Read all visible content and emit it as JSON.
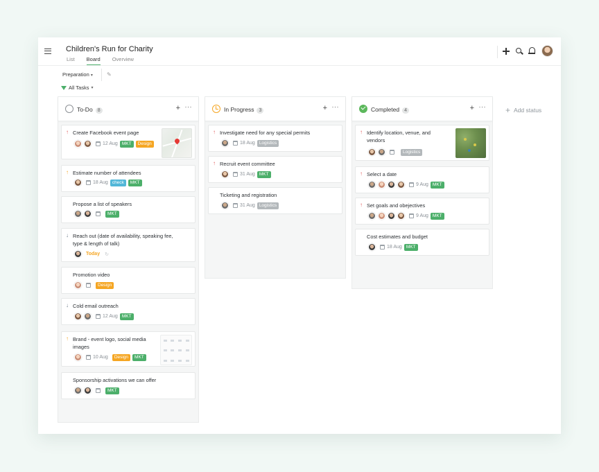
{
  "header": {
    "project_title": "Children's Run for Charity",
    "tabs": [
      {
        "label": "List"
      },
      {
        "label": "Board"
      },
      {
        "label": "Overview"
      }
    ],
    "active_tab": "Board",
    "icons": [
      "plus-icon",
      "search-icon",
      "bell-icon",
      "user-avatar"
    ]
  },
  "toolbar": {
    "section_label": "Preparation",
    "filter_label": "All Tasks"
  },
  "colors": {
    "accent_green": "#4caf6a",
    "design_orange": "#f5a623",
    "check_blue": "#52b7d8",
    "logistics_gray": "#b3b8bb",
    "priority_high": "#e05a5a"
  },
  "columns": [
    {
      "title": "To-Do",
      "count": "8",
      "cards": [
        {
          "title": "Create Facebook event page",
          "date": "12 Aug",
          "tags": [
            "MKT",
            "Design"
          ]
        },
        {
          "title": "Estimate number of attendees",
          "date": "18 Aug",
          "tags": [
            "check",
            "MKT"
          ]
        },
        {
          "title": "Propose a list of speakers",
          "date": "",
          "tags": [
            "MKT"
          ]
        },
        {
          "title_line1": "Reach out (date of availability, speaking fee,",
          "title_line2": "type & length of talk)",
          "date": "Today",
          "tags": []
        },
        {
          "title": "Promotion video",
          "date": "",
          "tags": [
            "Design"
          ]
        },
        {
          "title": "Cold email outreach",
          "date": "12 Aug",
          "tags": [
            "MKT"
          ]
        },
        {
          "title_line1": "Brand - event logo, social media",
          "title_line2": "images",
          "date": "10 Aug",
          "tags": [
            "Design",
            "MKT"
          ]
        },
        {
          "title": "Sponsorship activations we can offer",
          "date": "",
          "tags": [
            "MKT"
          ]
        }
      ]
    },
    {
      "title": "In Progress",
      "count": "3",
      "cards": [
        {
          "title": "Investigate need for any special permits",
          "date": "18 Aug",
          "tags": [
            "Logistics"
          ]
        },
        {
          "title": "Recruit event committee",
          "date": "31 Aug",
          "tags": [
            "MKT"
          ]
        },
        {
          "title": "Ticketing and registration",
          "date": "31 Aug",
          "tags": [
            "Logistics"
          ]
        }
      ]
    },
    {
      "title": "Completed",
      "count": "4",
      "cards": [
        {
          "title_line1": "Identify location, venue, and",
          "title_line2": "vendors",
          "date": "",
          "tags": [
            "Logistics"
          ]
        },
        {
          "title": "Select a date",
          "date": "9 Aug",
          "tags": [
            "MKT"
          ]
        },
        {
          "title": "Set goals and obejectives",
          "date": "9 Aug",
          "tags": [
            "MKT"
          ]
        },
        {
          "title": "Cost estimates and budget",
          "date": "18 Aug",
          "tags": [
            "MKT"
          ]
        }
      ]
    }
  ],
  "add_status_label": "Add status"
}
